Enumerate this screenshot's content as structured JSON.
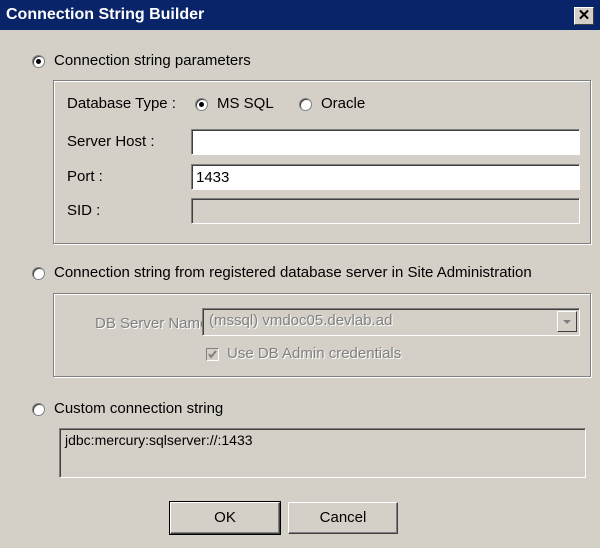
{
  "window": {
    "title": "Connection String Builder",
    "close_glyph": "✕"
  },
  "params": {
    "radio_label": "Connection string parameters",
    "database_type_label": "Database Type :",
    "ms_sql_label": "MS SQL",
    "oracle_label": "Oracle",
    "server_host_label": "Server Host :",
    "server_host_value": "",
    "port_label": "Port :",
    "port_value": "1433",
    "sid_label": "SID :",
    "sid_value": ""
  },
  "registered": {
    "radio_label": "Connection string from registered database server in Site Administration",
    "db_server_name_label": "DB Server Name :",
    "db_server_name_value": "(mssql) vmdoc05.devlab.ad",
    "use_admin_label": "Use DB Admin credentials"
  },
  "custom": {
    "radio_label": "Custom connection string",
    "value": "jdbc:mercury:sqlserver://:1433"
  },
  "buttons": {
    "ok": "OK",
    "cancel": "Cancel"
  }
}
